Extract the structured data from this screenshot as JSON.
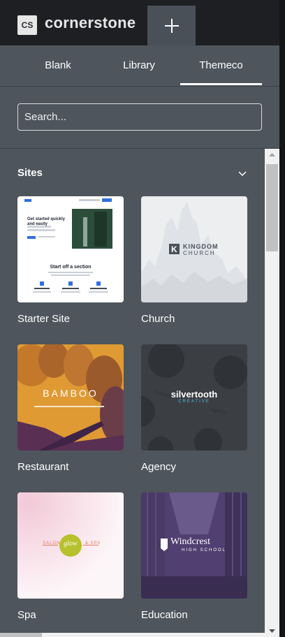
{
  "app": {
    "logo_badge": "CS",
    "logo_word": "cornerstone"
  },
  "tabs": [
    {
      "label": "Blank"
    },
    {
      "label": "Library"
    },
    {
      "label": "Themeco",
      "active": true
    }
  ],
  "search": {
    "placeholder": "Search..."
  },
  "section": {
    "title": "Sites",
    "collapsed": false
  },
  "cards": [
    {
      "label": "Starter Site",
      "thumb_heading": "Get started quickly and easily",
      "thumb_sub": "Start off a section"
    },
    {
      "label": "Church",
      "thumb_text_1": "KINGDOM",
      "thumb_text_2": "CHURCH"
    },
    {
      "label": "Restaurant",
      "thumb_text_1": "BAMBOO"
    },
    {
      "label": "Agency",
      "thumb_text_1": "silvertooth",
      "thumb_text_2": "CREATIVE"
    },
    {
      "label": "Spa",
      "thumb_text_1": "SALON",
      "thumb_text_2": "& SPA",
      "thumb_text_3": "glow"
    },
    {
      "label": "Education",
      "thumb_text_1": "Windcrest",
      "thumb_text_2": "HIGH SCHOOL"
    }
  ],
  "colors": {
    "panel": "#4e555d",
    "topbar": "#1d1f22",
    "accent": "#ffffff"
  }
}
